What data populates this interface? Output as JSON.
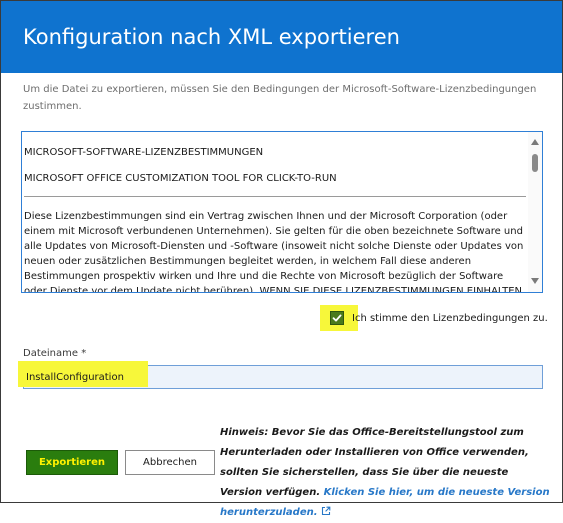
{
  "header": {
    "title": "Konfiguration nach XML exportieren"
  },
  "intro": {
    "text": "Um die Datei zu exportieren, müssen Sie den Bedingungen der Microsoft-Software-Lizenzbedingungen zustimmen."
  },
  "license": {
    "heading1": "MICROSOFT-SOFTWARE-LIZENZBESTIMMUNGEN",
    "heading2": "MICROSOFT OFFICE CUSTOMIZATION TOOL FOR CLICK-TO-RUN",
    "body": "Diese Lizenzbestimmungen sind ein Vertrag zwischen Ihnen und der Microsoft Corporation (oder einem mit Microsoft verbundenen Unternehmen). Sie gelten für die oben bezeichnete Software und alle Updates von Microsoft-Diensten und -Software (insoweit nicht solche Dienste oder Updates von neuen oder zusätzlichen Bestimmungen begleitet werden, in welchem Fall diese anderen Bestimmungen prospektiv wirken und Ihre und die Rechte von Microsoft bezüglich der Software oder Dienste vor dem Update nicht berühren). WENN SIE DIESE LIZENZBESTIMMUNGEN EINHALTEN"
  },
  "accept": {
    "label": "Ich stimme den Lizenzbedingungen zu.",
    "checked": true
  },
  "file": {
    "label": "Dateiname *",
    "value": "InstallConfiguration"
  },
  "buttons": {
    "export": "Exportieren",
    "cancel": "Abbrechen"
  },
  "hint": {
    "text": "Hinweis: Bevor Sie das Office-Bereitstellungstool zum Herunterladen oder Installieren von Office verwenden, sollten Sie sicherstellen, dass Sie über die neueste Version verfügen.",
    "link": "Klicken Sie hier, um die neueste Version herunterzuladen."
  },
  "colors": {
    "header_bg": "#0f73cf",
    "highlight": "#f7f73a",
    "export_bg": "#2a7d0e",
    "export_text": "#fff100",
    "link": "#2878c8"
  },
  "icons": {
    "scroll_up": "scroll-up-arrow-icon",
    "scroll_down": "scroll-down-arrow-icon",
    "checkmark": "checkmark-icon",
    "external_link": "external-link-icon"
  }
}
